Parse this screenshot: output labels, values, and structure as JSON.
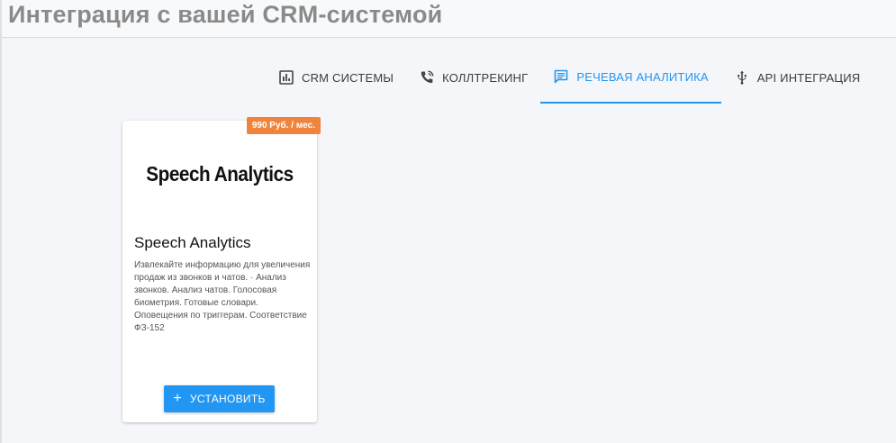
{
  "header": {
    "title": "Интеграция с вашей CRM-системой"
  },
  "tabs": [
    {
      "label": "CRM системы",
      "icon": "chart-icon",
      "active": false
    },
    {
      "label": "Коллтрекинг",
      "icon": "phone-wifi-icon",
      "active": false
    },
    {
      "label": "Речевая аналитика",
      "icon": "message-icon",
      "active": true
    },
    {
      "label": "API интеграция",
      "icon": "usb-icon",
      "active": false
    }
  ],
  "card": {
    "price": "990 Руб. / мес.",
    "logo_text": "Speech Analytics",
    "title": "Speech Analytics",
    "description": "Извлекайте информацию для увеличения продаж из звонков и чатов. · Анализ звонков. Анализ чатов. Голосовая биометрия. Готовые словари. Оповещения по триггерам. Соответствие ФЗ-152",
    "install_label": "Установить"
  },
  "colors": {
    "accent": "#2196f3",
    "price_badge": "#f0843c",
    "title_gray": "#8a8a8a"
  }
}
